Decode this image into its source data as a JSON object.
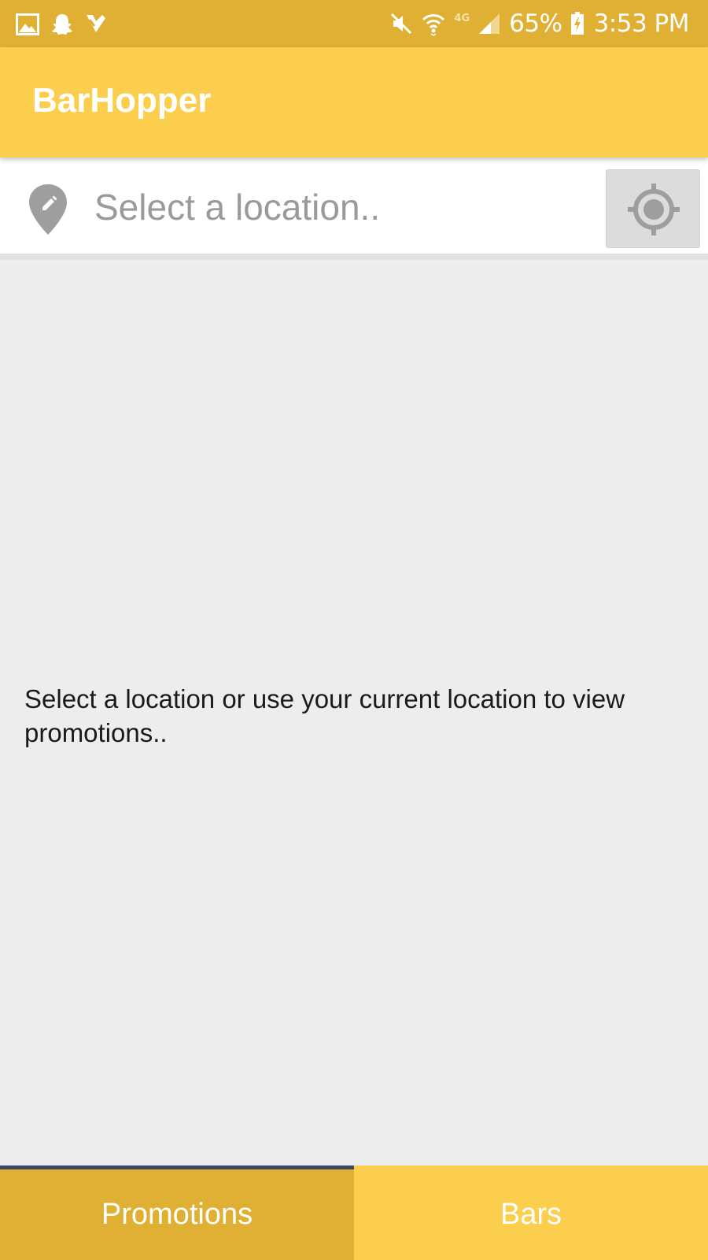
{
  "status_bar": {
    "notification_icons": [
      "gallery-icon",
      "snapchat-icon",
      "checkmark-app-icon"
    ],
    "system_icons": [
      "mute-icon",
      "wifi-icon",
      "lte-icon",
      "signal-icon",
      "battery-charging-icon"
    ],
    "network_label": "4G",
    "battery_percent": "65%",
    "time": "3:53 PM"
  },
  "app_bar": {
    "title": "BarHopper"
  },
  "location_bar": {
    "pin_icon": "location-pin-edit-icon",
    "input_value": "",
    "input_placeholder": "Select a location..",
    "locate_button_icon": "gps-crosshair-icon"
  },
  "main": {
    "empty_message": "Select a location or use your current location to view promotions.."
  },
  "bottom_tabs": {
    "tabs": [
      {
        "label": "Promotions",
        "selected": true
      },
      {
        "label": "Bars",
        "selected": false
      }
    ]
  },
  "colors": {
    "status_bar": "#dfb033",
    "app_bar": "#fcce4e",
    "tab_selected": "#dfb033",
    "tab_unselected": "#fcce4e",
    "tab_indicator": "#3a4a63",
    "background": "#ededed"
  }
}
